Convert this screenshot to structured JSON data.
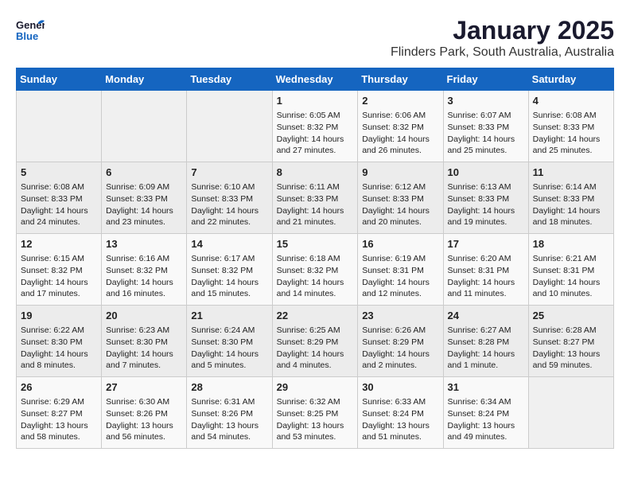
{
  "header": {
    "logo_line1": "General",
    "logo_line2": "Blue",
    "title": "January 2025",
    "subtitle": "Flinders Park, South Australia, Australia"
  },
  "days_of_week": [
    "Sunday",
    "Monday",
    "Tuesday",
    "Wednesday",
    "Thursday",
    "Friday",
    "Saturday"
  ],
  "weeks": [
    [
      {
        "day": "",
        "empty": true
      },
      {
        "day": "",
        "empty": true
      },
      {
        "day": "",
        "empty": true
      },
      {
        "day": "1",
        "sunrise": "6:05 AM",
        "sunset": "8:32 PM",
        "daylight": "14 hours and 27 minutes."
      },
      {
        "day": "2",
        "sunrise": "6:06 AM",
        "sunset": "8:32 PM",
        "daylight": "14 hours and 26 minutes."
      },
      {
        "day": "3",
        "sunrise": "6:07 AM",
        "sunset": "8:33 PM",
        "daylight": "14 hours and 25 minutes."
      },
      {
        "day": "4",
        "sunrise": "6:08 AM",
        "sunset": "8:33 PM",
        "daylight": "14 hours and 25 minutes."
      }
    ],
    [
      {
        "day": "5",
        "sunrise": "6:08 AM",
        "sunset": "8:33 PM",
        "daylight": "14 hours and 24 minutes."
      },
      {
        "day": "6",
        "sunrise": "6:09 AM",
        "sunset": "8:33 PM",
        "daylight": "14 hours and 23 minutes."
      },
      {
        "day": "7",
        "sunrise": "6:10 AM",
        "sunset": "8:33 PM",
        "daylight": "14 hours and 22 minutes."
      },
      {
        "day": "8",
        "sunrise": "6:11 AM",
        "sunset": "8:33 PM",
        "daylight": "14 hours and 21 minutes."
      },
      {
        "day": "9",
        "sunrise": "6:12 AM",
        "sunset": "8:33 PM",
        "daylight": "14 hours and 20 minutes."
      },
      {
        "day": "10",
        "sunrise": "6:13 AM",
        "sunset": "8:33 PM",
        "daylight": "14 hours and 19 minutes."
      },
      {
        "day": "11",
        "sunrise": "6:14 AM",
        "sunset": "8:33 PM",
        "daylight": "14 hours and 18 minutes."
      }
    ],
    [
      {
        "day": "12",
        "sunrise": "6:15 AM",
        "sunset": "8:32 PM",
        "daylight": "14 hours and 17 minutes."
      },
      {
        "day": "13",
        "sunrise": "6:16 AM",
        "sunset": "8:32 PM",
        "daylight": "14 hours and 16 minutes."
      },
      {
        "day": "14",
        "sunrise": "6:17 AM",
        "sunset": "8:32 PM",
        "daylight": "14 hours and 15 minutes."
      },
      {
        "day": "15",
        "sunrise": "6:18 AM",
        "sunset": "8:32 PM",
        "daylight": "14 hours and 14 minutes."
      },
      {
        "day": "16",
        "sunrise": "6:19 AM",
        "sunset": "8:31 PM",
        "daylight": "14 hours and 12 minutes."
      },
      {
        "day": "17",
        "sunrise": "6:20 AM",
        "sunset": "8:31 PM",
        "daylight": "14 hours and 11 minutes."
      },
      {
        "day": "18",
        "sunrise": "6:21 AM",
        "sunset": "8:31 PM",
        "daylight": "14 hours and 10 minutes."
      }
    ],
    [
      {
        "day": "19",
        "sunrise": "6:22 AM",
        "sunset": "8:30 PM",
        "daylight": "14 hours and 8 minutes."
      },
      {
        "day": "20",
        "sunrise": "6:23 AM",
        "sunset": "8:30 PM",
        "daylight": "14 hours and 7 minutes."
      },
      {
        "day": "21",
        "sunrise": "6:24 AM",
        "sunset": "8:30 PM",
        "daylight": "14 hours and 5 minutes."
      },
      {
        "day": "22",
        "sunrise": "6:25 AM",
        "sunset": "8:29 PM",
        "daylight": "14 hours and 4 minutes."
      },
      {
        "day": "23",
        "sunrise": "6:26 AM",
        "sunset": "8:29 PM",
        "daylight": "14 hours and 2 minutes."
      },
      {
        "day": "24",
        "sunrise": "6:27 AM",
        "sunset": "8:28 PM",
        "daylight": "14 hours and 1 minute."
      },
      {
        "day": "25",
        "sunrise": "6:28 AM",
        "sunset": "8:27 PM",
        "daylight": "13 hours and 59 minutes."
      }
    ],
    [
      {
        "day": "26",
        "sunrise": "6:29 AM",
        "sunset": "8:27 PM",
        "daylight": "13 hours and 58 minutes."
      },
      {
        "day": "27",
        "sunrise": "6:30 AM",
        "sunset": "8:26 PM",
        "daylight": "13 hours and 56 minutes."
      },
      {
        "day": "28",
        "sunrise": "6:31 AM",
        "sunset": "8:26 PM",
        "daylight": "13 hours and 54 minutes."
      },
      {
        "day": "29",
        "sunrise": "6:32 AM",
        "sunset": "8:25 PM",
        "daylight": "13 hours and 53 minutes."
      },
      {
        "day": "30",
        "sunrise": "6:33 AM",
        "sunset": "8:24 PM",
        "daylight": "13 hours and 51 minutes."
      },
      {
        "day": "31",
        "sunrise": "6:34 AM",
        "sunset": "8:24 PM",
        "daylight": "13 hours and 49 minutes."
      },
      {
        "day": "",
        "empty": true
      }
    ]
  ],
  "labels": {
    "sunrise_prefix": "Sunrise: ",
    "sunset_prefix": "Sunset: ",
    "daylight_prefix": "Daylight: "
  }
}
